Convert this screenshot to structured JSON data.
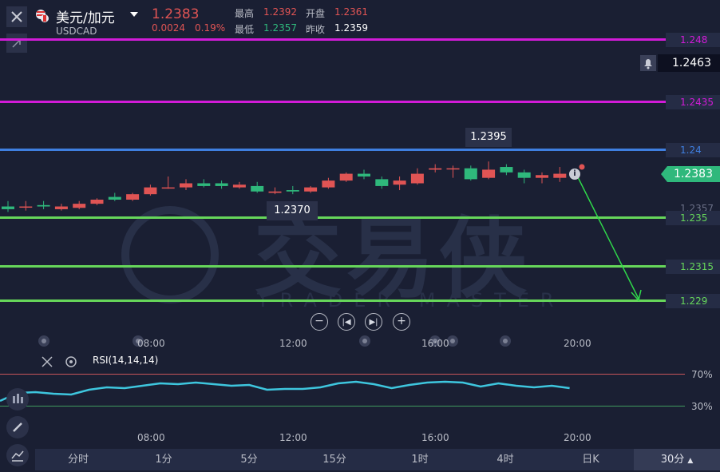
{
  "header": {
    "pair_name": "美元/加元",
    "symbol": "USDCAD",
    "price": "1.2383",
    "change": "0.0024",
    "change_pct": "0.19%",
    "high_label": "最高",
    "high_value": "1.2392",
    "open_label": "开盘",
    "open_value": "1.2361",
    "low_label": "最低",
    "low_value": "1.2357",
    "prev_close_label": "昨收",
    "prev_close_value": "1.2359"
  },
  "price_levels": {
    "l1248": "1.248",
    "alert_price": "1.2463",
    "l12435": "1.2435",
    "l124": "1.24",
    "current": "1.2383",
    "l12357": "1.2357",
    "l1235": "1.235",
    "l12315": "1.2315",
    "l1229": "1.229"
  },
  "annotations": {
    "high_marker": "1.2395",
    "low_marker": "1.2370"
  },
  "watermark": {
    "cn": "交易侠",
    "en": "TRADER MASTER"
  },
  "time_axis": [
    "08:00",
    "12:00",
    "16:00",
    "20:00"
  ],
  "rsi": {
    "label": "RSI(14,14,14)",
    "upper": "70%",
    "lower": "30%"
  },
  "timeframes": [
    "分时",
    "1分",
    "5分",
    "15分",
    "1时",
    "4时",
    "日K"
  ],
  "active_timeframe": "30分",
  "colors": {
    "up": "#e05454",
    "down": "#2fb87c",
    "magenta": "#d21bd8",
    "blue": "#3f7fe0",
    "green": "#66d65a",
    "rsi": "#3ec6de"
  },
  "chart_data": {
    "type": "candlestick",
    "y_range": [
      1.2285,
      1.249
    ],
    "candles": [
      {
        "o": 1.2362,
        "h": 1.2366,
        "l": 1.2358,
        "c": 1.236
      },
      {
        "o": 1.2362,
        "h": 1.2366,
        "l": 1.2359,
        "c": 1.2362
      },
      {
        "o": 1.2363,
        "h": 1.2366,
        "l": 1.236,
        "c": 1.2362
      },
      {
        "o": 1.236,
        "h": 1.2364,
        "l": 1.2359,
        "c": 1.2362
      },
      {
        "o": 1.2361,
        "h": 1.2366,
        "l": 1.236,
        "c": 1.2364
      },
      {
        "o": 1.2364,
        "h": 1.2368,
        "l": 1.2363,
        "c": 1.2367
      },
      {
        "o": 1.2369,
        "h": 1.2372,
        "l": 1.2366,
        "c": 1.2367
      },
      {
        "o": 1.2367,
        "h": 1.2372,
        "l": 1.2366,
        "c": 1.2371
      },
      {
        "o": 1.2371,
        "h": 1.2378,
        "l": 1.237,
        "c": 1.2376
      },
      {
        "o": 1.2376,
        "h": 1.2384,
        "l": 1.2375,
        "c": 1.2376
      },
      {
        "o": 1.2376,
        "h": 1.2382,
        "l": 1.2374,
        "c": 1.2379
      },
      {
        "o": 1.2379,
        "h": 1.2382,
        "l": 1.2376,
        "c": 1.2377
      },
      {
        "o": 1.2379,
        "h": 1.2381,
        "l": 1.2375,
        "c": 1.2377
      },
      {
        "o": 1.2376,
        "h": 1.238,
        "l": 1.2375,
        "c": 1.2378
      },
      {
        "o": 1.2377,
        "h": 1.238,
        "l": 1.2372,
        "c": 1.2373
      },
      {
        "o": 1.2372,
        "h": 1.2376,
        "l": 1.2371,
        "c": 1.2373
      },
      {
        "o": 1.2374,
        "h": 1.2377,
        "l": 1.2371,
        "c": 1.2373
      },
      {
        "o": 1.2373,
        "h": 1.2377,
        "l": 1.2372,
        "c": 1.2376
      },
      {
        "o": 1.2376,
        "h": 1.2383,
        "l": 1.2375,
        "c": 1.2381
      },
      {
        "o": 1.2381,
        "h": 1.2387,
        "l": 1.238,
        "c": 1.2386
      },
      {
        "o": 1.2386,
        "h": 1.2389,
        "l": 1.2382,
        "c": 1.2384
      },
      {
        "o": 1.2382,
        "h": 1.2384,
        "l": 1.2375,
        "c": 1.2377
      },
      {
        "o": 1.2378,
        "h": 1.2384,
        "l": 1.2374,
        "c": 1.2381
      },
      {
        "o": 1.2379,
        "h": 1.239,
        "l": 1.2378,
        "c": 1.2386
      },
      {
        "o": 1.2389,
        "h": 1.2393,
        "l": 1.2387,
        "c": 1.239
      },
      {
        "o": 1.239,
        "h": 1.2392,
        "l": 1.2383,
        "c": 1.239
      },
      {
        "o": 1.239,
        "h": 1.2392,
        "l": 1.2381,
        "c": 1.2382
      },
      {
        "o": 1.2383,
        "h": 1.2395,
        "l": 1.2382,
        "c": 1.2389
      },
      {
        "o": 1.2391,
        "h": 1.2393,
        "l": 1.2385,
        "c": 1.2387
      },
      {
        "o": 1.2387,
        "h": 1.2389,
        "l": 1.2379,
        "c": 1.2383
      },
      {
        "o": 1.2383,
        "h": 1.2387,
        "l": 1.2379,
        "c": 1.2385
      },
      {
        "o": 1.2383,
        "h": 1.2391,
        "l": 1.238,
        "c": 1.2386
      }
    ],
    "rsi_values": [
      36,
      46,
      47,
      45,
      44,
      50,
      53,
      52,
      55,
      58,
      57,
      59,
      57,
      55,
      56,
      50,
      51,
      51,
      53,
      58,
      60,
      57,
      52,
      56,
      59,
      60,
      59,
      54,
      58,
      55,
      53,
      55,
      52
    ]
  }
}
